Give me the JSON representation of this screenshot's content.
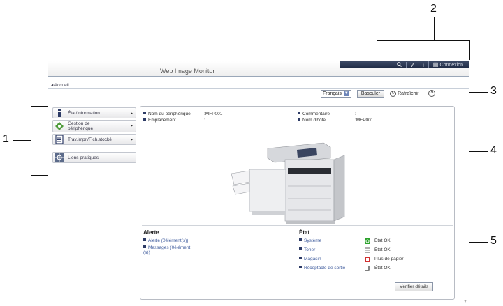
{
  "callouts": {
    "c1": "1",
    "c2": "2",
    "c3": "3",
    "c4": "4",
    "c5": "5"
  },
  "app_title": "Web Image Monitor",
  "utility": {
    "search_icon": "search-icon",
    "help_label": "?",
    "info_label": "i",
    "login_label": "Connexion"
  },
  "breadcrumb": "◂ Accueil",
  "toolbar": {
    "language": "Français",
    "basculer": "Basculer",
    "refresh": "Rafraîchir",
    "help": "?"
  },
  "sidebar": {
    "items": [
      {
        "label": "État/Information",
        "icon": "info-icon"
      },
      {
        "label": "Gestion de\npériphérique",
        "icon": "device-management-icon"
      },
      {
        "label": "Trav.impr./Fich.stocké",
        "icon": "stored-file-icon"
      },
      {
        "label": "Liens pratiques",
        "icon": "links-icon"
      }
    ]
  },
  "device": {
    "name_label": "Nom du périphérique",
    "name_value": ":MFP001",
    "location_label": "Emplacement",
    "location_value": ":",
    "comment_label": "Commentaire",
    "comment_value": ":",
    "host_label": "Nom d'hôte",
    "host_value": ":MFP001"
  },
  "alert": {
    "title": "Alerte",
    "items": [
      "Alerte (0élément(s))",
      "Messages (0élément\n(s))"
    ]
  },
  "status": {
    "title": "État",
    "rows": [
      {
        "name": "Système",
        "value": "État OK",
        "icon": "ok-icon",
        "color": "#2aa12a"
      },
      {
        "name": "Toner",
        "value": "État OK",
        "icon": "toner-icon",
        "color": "#333333"
      },
      {
        "name": "Magasin",
        "value": "Plus de papier",
        "icon": "paper-empty-icon",
        "color": "#d03030"
      },
      {
        "name": "Réceptacle de sortie",
        "value": "État OK",
        "icon": "output-tray-icon",
        "color": "#333333"
      }
    ]
  },
  "detail_button": "Vérifier détails"
}
